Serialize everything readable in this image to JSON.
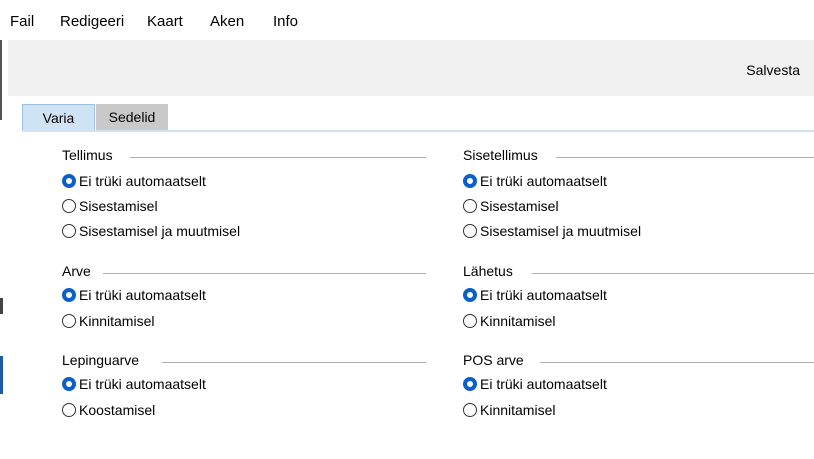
{
  "menu": [
    "Fail",
    "Redigeeri",
    "Kaart",
    "Aken",
    "Info"
  ],
  "toolbar": {
    "save_label": "Salvesta"
  },
  "tabs": [
    {
      "label": "Varia",
      "active": true
    },
    {
      "label": "Sedelid",
      "active": false
    }
  ],
  "groups": {
    "tellimus": {
      "title": "Tellimus",
      "options": [
        "Ei trüki automaatselt",
        "Sisestamisel",
        "Sisestamisel ja muutmisel"
      ],
      "selected": 0
    },
    "sisetellimus": {
      "title": "Sisetellimus",
      "options": [
        "Ei trüki automaatselt",
        "Sisestamisel",
        "Sisestamisel ja muutmisel"
      ],
      "selected": 0
    },
    "arve": {
      "title": "Arve",
      "options": [
        "Ei trüki automaatselt",
        "Kinnitamisel"
      ],
      "selected": 0
    },
    "lahetus": {
      "title": "Lähetus",
      "options": [
        "Ei trüki automaatselt",
        "Kinnitamisel"
      ],
      "selected": 0
    },
    "lepinguarve": {
      "title": "Lepinguarve",
      "options": [
        "Ei trüki automaatselt",
        "Koostamisel"
      ],
      "selected": 0
    },
    "pos_arve": {
      "title": "POS arve",
      "options": [
        "Ei trüki automaatselt",
        "Kinnitamisel"
      ],
      "selected": 0
    }
  },
  "colors": {
    "radio_checked": "#0a5fc9",
    "tab_active": "#cfe3f5",
    "tab_inactive": "#c9c9c9",
    "toolbar_bg": "#f0f0f0"
  }
}
